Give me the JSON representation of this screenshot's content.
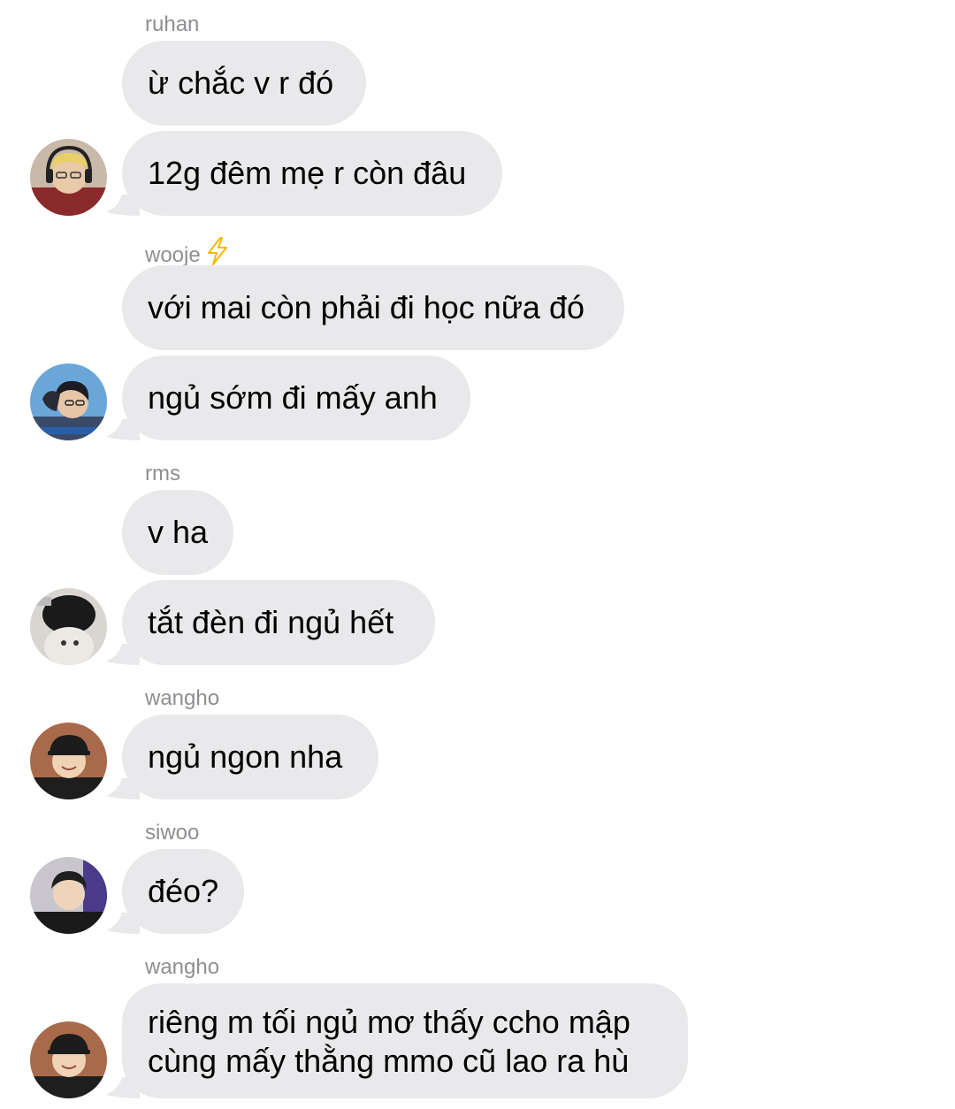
{
  "messages": [
    {
      "sender": "ruhan",
      "bubbles": [
        "ừ chắc v r đó",
        "12g đêm mẹ r còn đâu"
      ]
    },
    {
      "sender": "wooje",
      "sender_icon": "lightning-icon",
      "bubbles": [
        "với mai còn phải đi học nữa đó",
        "ngủ sớm đi mấy anh"
      ]
    },
    {
      "sender": "rms",
      "bubbles": [
        "v ha",
        "tắt đèn đi ngủ hết"
      ]
    },
    {
      "sender": "wangho",
      "bubbles": [
        "ngủ ngon nha"
      ]
    },
    {
      "sender": "siwoo",
      "bubbles": [
        "đéo?"
      ]
    },
    {
      "sender": "wangho",
      "bubbles": [
        "riêng m tối ngủ mơ thấy ccho mập cùng mấy thằng mmo cũ lao ra hù"
      ]
    }
  ],
  "colors": {
    "bubble_bg": "#e9e9eb",
    "sender_text": "#8e8e93",
    "message_text": "#000000",
    "bolt": "#f5b800"
  }
}
